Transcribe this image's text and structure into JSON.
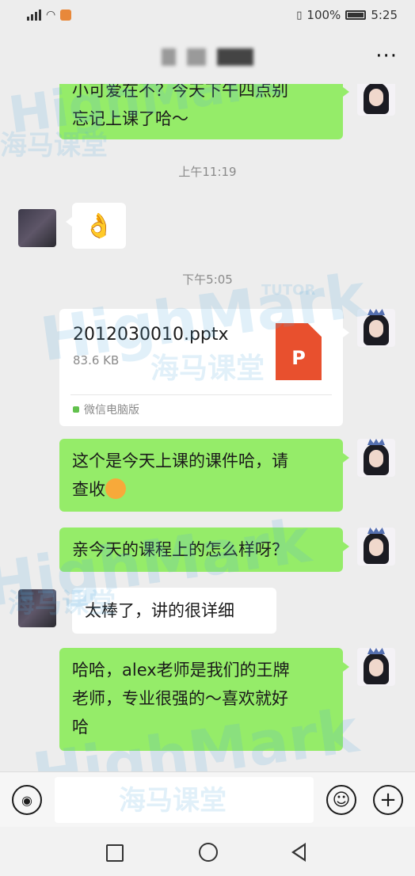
{
  "status_bar": {
    "battery_percent": "100%",
    "time": "5:25"
  },
  "header": {
    "more_label": "···"
  },
  "chat": {
    "messages": [
      {
        "side": "right",
        "type": "text",
        "lines": [
          "小可爱在不？今天下午四点别",
          "忘记上课了哈～"
        ]
      },
      {
        "type": "timestamp",
        "text": "上午11:19"
      },
      {
        "side": "left",
        "type": "emoji",
        "emoji": "👌"
      },
      {
        "type": "timestamp",
        "text": "下午5:05"
      },
      {
        "side": "right",
        "type": "file",
        "file_name": "2012030010.pptx",
        "file_size": "83.6 KB",
        "file_icon_letter": "P",
        "source": "微信电脑版"
      },
      {
        "side": "right",
        "type": "text",
        "lines": [
          "这个是今天上课的课件哈，请",
          "查收"
        ]
      },
      {
        "side": "right",
        "type": "text",
        "lines": [
          "亲今天的课程上的怎么样呀？"
        ]
      },
      {
        "side": "left",
        "type": "text",
        "lines": [
          "太棒了，讲的很详细"
        ]
      },
      {
        "side": "right",
        "type": "text",
        "lines": [
          "哈哈，alex老师是我们的王牌",
          "老师，专业很强的～喜欢就好",
          "哈"
        ]
      }
    ]
  },
  "input_bar": {
    "voice_icon": "voice-icon",
    "emoji_icon": "emoji-icon",
    "plus_icon": "plus-icon",
    "placeholder": ""
  },
  "watermark": {
    "brand": "HighMark",
    "tag": "TUTOR",
    "cn": "海马课堂"
  },
  "colors": {
    "background": "#ededed",
    "bubble_green": "#95ec69",
    "bubble_white": "#ffffff",
    "file_icon": "#e8502e"
  }
}
